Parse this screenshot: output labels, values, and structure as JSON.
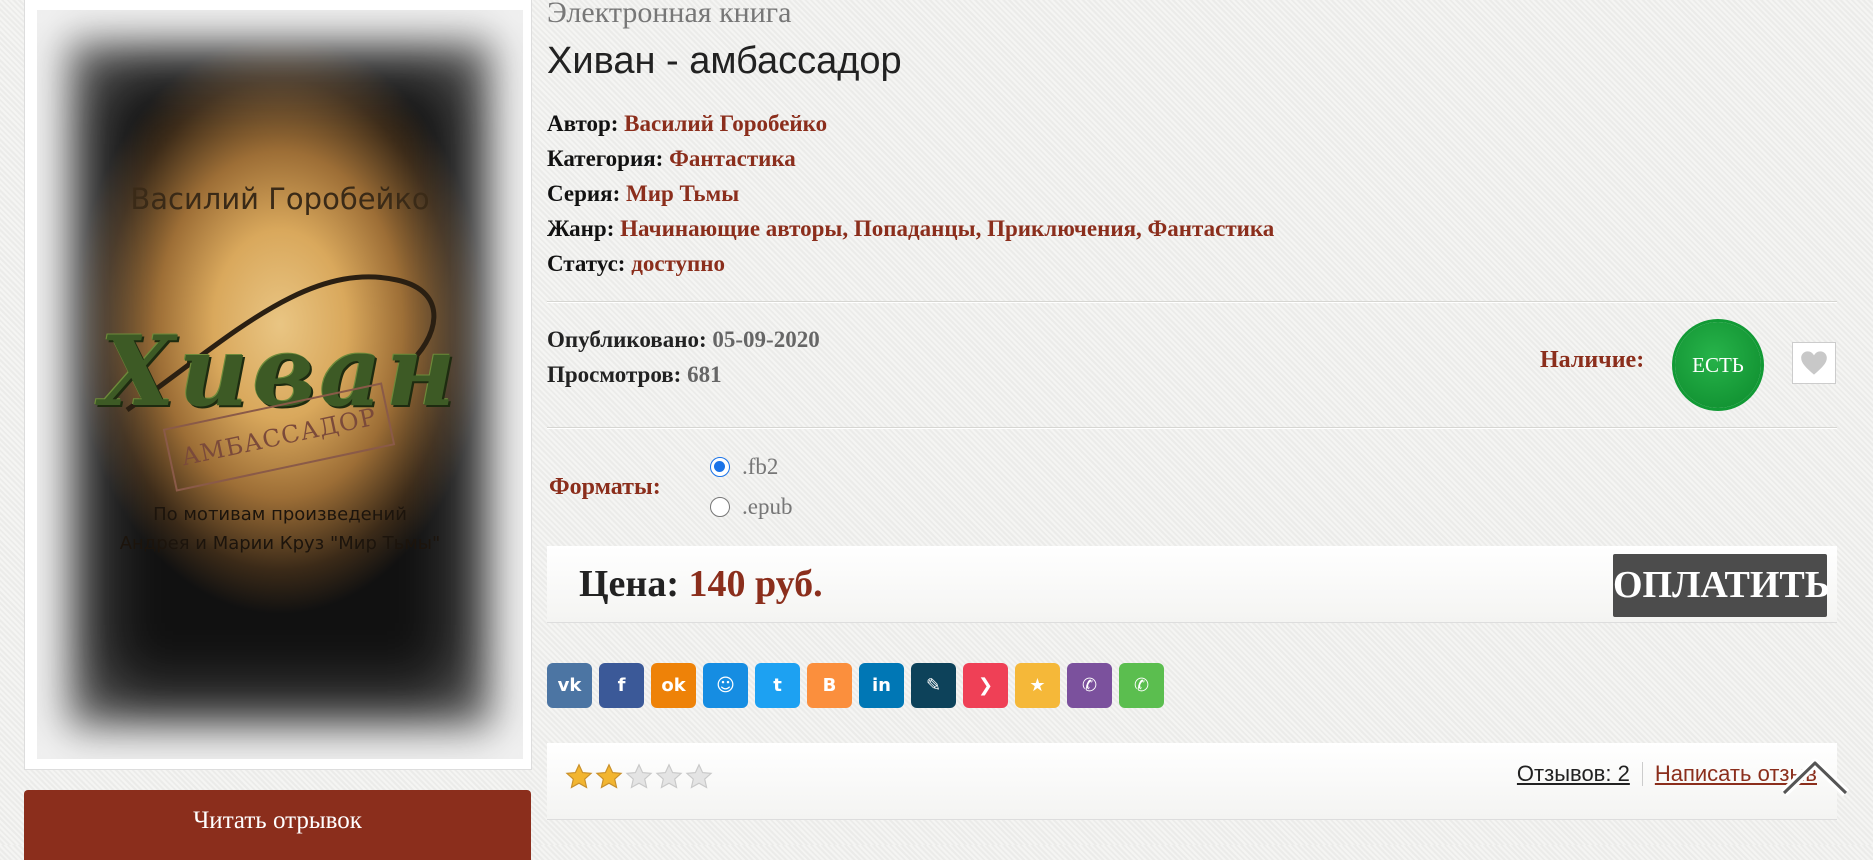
{
  "cover": {
    "author": "Василий Горобейко",
    "title": "Хиван",
    "subtitle": "АМБАССАДОР",
    "tagline_1": "По мотивам произведений",
    "tagline_2": "Андрея и Марии Круз \"Мир Тьмы\""
  },
  "read_button": "Читать отрывок",
  "kind": "Электронная книга",
  "title": "Хиван - амбассадор",
  "meta": {
    "author_label": "Автор:",
    "author": "Василий Горобейко",
    "category_label": "Категория:",
    "category": "Фантастика",
    "series_label": "Серия:",
    "series": "Мир Тьмы",
    "genre_label": "Жанр:",
    "genres": [
      "Начинающие авторы",
      "Попаданцы",
      "Приключения",
      "Фантастика"
    ],
    "status_label": "Статус:",
    "status": "доступно"
  },
  "stats": {
    "published_label": "Опубликовано:",
    "published": "05-09-2020",
    "views_label": "Просмотров:",
    "views": "681"
  },
  "availability": {
    "label": "Наличие:",
    "badge": "ЕСТЬ"
  },
  "formats": {
    "label": "Форматы:",
    "options": [
      {
        "label": ".fb2",
        "selected": true
      },
      {
        "label": ".epub",
        "selected": false
      }
    ]
  },
  "price": {
    "label": "Цена:",
    "amount": "140 руб.",
    "pay_button": "ОПЛАТИТЬ"
  },
  "share": [
    {
      "name": "vk",
      "color": "#4c75a3",
      "glyph": "vk"
    },
    {
      "name": "facebook",
      "color": "#3b5998",
      "glyph": "f"
    },
    {
      "name": "odnoklassniki",
      "color": "#ee8208",
      "glyph": "ok"
    },
    {
      "name": "moimir",
      "color": "#168de2",
      "glyph": "☺"
    },
    {
      "name": "twitter",
      "color": "#1da1f2",
      "glyph": "t"
    },
    {
      "name": "blogger",
      "color": "#fb8f3d",
      "glyph": "B"
    },
    {
      "name": "linkedin",
      "color": "#0077b5",
      "glyph": "in"
    },
    {
      "name": "livejournal",
      "color": "#0d425a",
      "glyph": "✎"
    },
    {
      "name": "pocket",
      "color": "#ef4056",
      "glyph": "❯"
    },
    {
      "name": "surfingbird",
      "color": "#f5b839",
      "glyph": "★"
    },
    {
      "name": "viber",
      "color": "#7b519d",
      "glyph": "✆"
    },
    {
      "name": "whatsapp",
      "color": "#5bbe4f",
      "glyph": "✆"
    }
  ],
  "rating": {
    "value": 2,
    "max": 5
  },
  "reviews": {
    "count_label": "Отзывов: 2",
    "write_label": "Написать отзыв"
  }
}
